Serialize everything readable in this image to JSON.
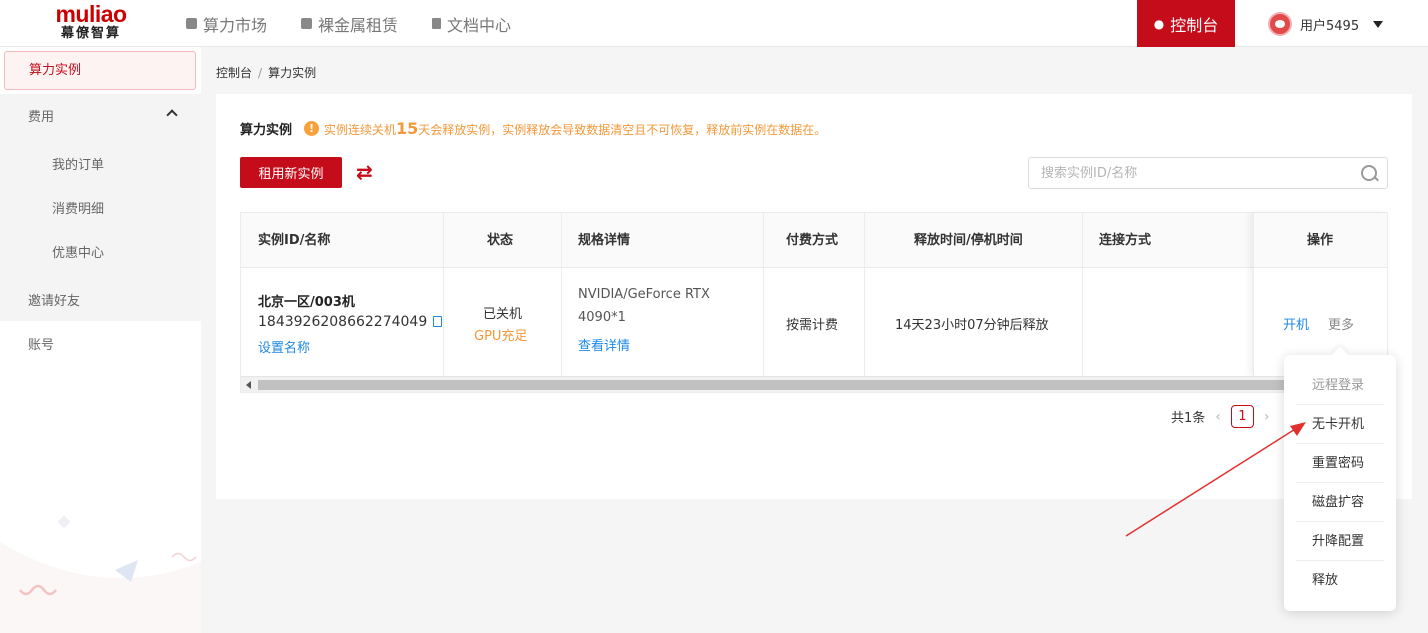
{
  "header": {
    "logo_top": "muliao",
    "logo_bottom": "幕僚智算",
    "nav": [
      {
        "label": "算力市场",
        "icon": "box-icon"
      },
      {
        "label": "裸金属租赁",
        "icon": "server-icon"
      },
      {
        "label": "文档中心",
        "icon": "document-icon"
      }
    ],
    "console_label": "控制台",
    "user_label": "用户5495"
  },
  "sidebar": {
    "active": "算力实例",
    "group_label": "费用",
    "group_items": [
      "我的订单",
      "消费明细",
      "优惠中心"
    ],
    "items": [
      "邀请好友",
      "账号"
    ]
  },
  "breadcrumb": {
    "root": "控制台",
    "sep": "/",
    "current": "算力实例"
  },
  "card": {
    "title": "算力实例",
    "warning_prefix": "实例连续关机",
    "warning_days": "15",
    "warning_suffix": "天会释放实例，实例释放会导致数据清空且不可恢复，释放前实例在数据在。",
    "rent_button": "租用新实例",
    "search_placeholder": "搜索实例ID/名称"
  },
  "table": {
    "columns": [
      "实例ID/名称",
      "状态",
      "规格详情",
      "付费方式",
      "释放时间/停机时间",
      "连接方式",
      "操作"
    ],
    "row": {
      "name": "北京一区/003机",
      "id": "1843926208662274049",
      "set_name": "设置名称",
      "status": "已关机",
      "status_sub": "GPU充足",
      "spec_line1": "NVIDIA/GeForce RTX",
      "spec_line2": "4090*1",
      "spec_link": "查看详情",
      "billing": "按需计费",
      "release": "14天23小时07分钟后释放",
      "connect": "",
      "op_start": "开机",
      "op_more": "更多"
    }
  },
  "pager": {
    "total": "共1条",
    "current_page": "1"
  },
  "dropdown": {
    "items": [
      "远程登录",
      "无卡开机",
      "重置密码",
      "磁盘扩容",
      "升降配置",
      "释放"
    ]
  },
  "colors": {
    "brand": "#c40c1a",
    "link": "#1e88e5",
    "warning": "#f2993a"
  }
}
